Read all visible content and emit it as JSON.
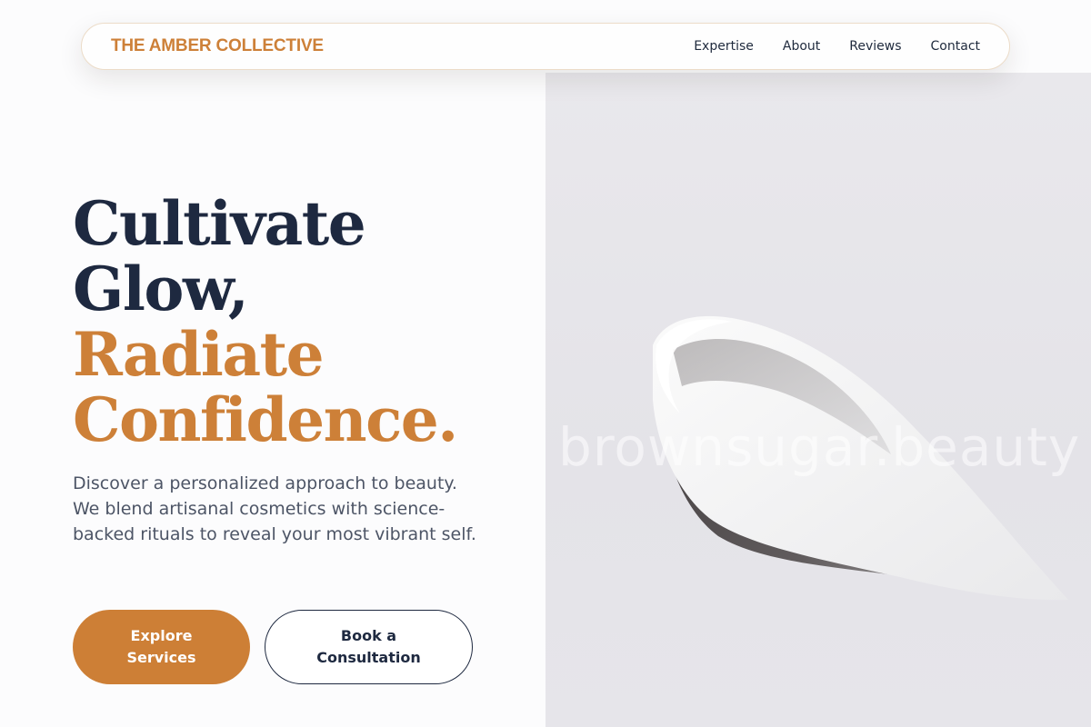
{
  "brand": {
    "name": "THE AMBER COLLECTIVE"
  },
  "nav": {
    "items": [
      {
        "label": "Expertise"
      },
      {
        "label": "About"
      },
      {
        "label": "Reviews"
      },
      {
        "label": "Contact"
      }
    ]
  },
  "hero": {
    "headline_line1": "Cultivate",
    "headline_line2": "Glow,",
    "headline_line3": "Radiate",
    "headline_line4": "Confidence.",
    "description": "Discover a personalized approach to beauty. We blend artisanal cosmetics with science-backed rituals to reveal your most vibrant self.",
    "primary_cta": "Explore Services",
    "secondary_cta": "Book a Consultation",
    "image_watermark": "brownsugar.beauty"
  },
  "colors": {
    "accent": "#cd8038",
    "navy": "#1e2940",
    "body_text": "#4d5566",
    "image_bg": "#e6e5ea"
  }
}
